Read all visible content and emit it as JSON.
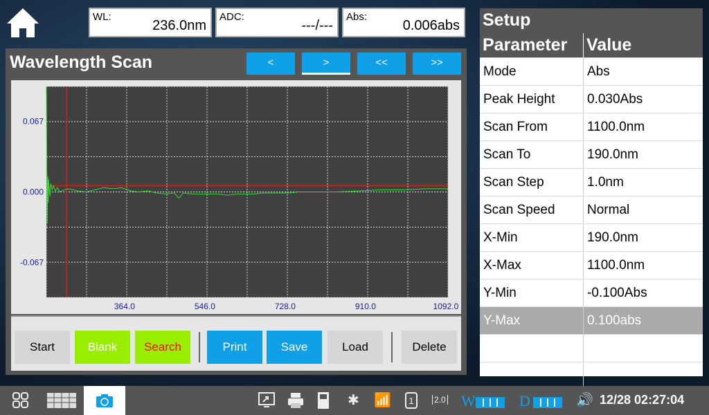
{
  "header": {
    "wl_label": "WL:",
    "wl_value": "236.0nm",
    "adc_label": "ADC:",
    "adc_value": "---/---",
    "abs_label": "Abs:",
    "abs_value": "0.006abs"
  },
  "panel": {
    "title": "Wavelength Scan",
    "nav": [
      "<",
      ">",
      "<<",
      ">>"
    ]
  },
  "buttons": {
    "start": "Start",
    "blank": "Blank",
    "search": "Search",
    "print": "Print",
    "save": "Save",
    "load": "Load",
    "delete": "Delete"
  },
  "colors": {
    "accent": "#10a0e8",
    "blank": "#99ee00",
    "search_text": "#ee1111",
    "trace": "#33dd33",
    "cursor": "#cc2222",
    "plot_bg": "#404040"
  },
  "setup": {
    "title": "Setup",
    "col_param": "Parameter",
    "col_value": "Value",
    "rows": [
      [
        "Mode",
        "Abs"
      ],
      [
        "Peak Height",
        "0.030Abs"
      ],
      [
        "Scan From",
        "1100.0nm"
      ],
      [
        "Scan To",
        "190.0nm"
      ],
      [
        "Scan Step",
        "1.0nm"
      ],
      [
        "Scan Speed",
        "Normal"
      ],
      [
        "X-Min",
        "190.0nm"
      ],
      [
        "X-Max",
        "1100.0nm"
      ],
      [
        "Y-Min",
        "-0.100Abs"
      ],
      [
        "Y-Max",
        "0.100abs"
      ]
    ],
    "selected_index": 9
  },
  "chart_data": {
    "type": "line",
    "xlim": [
      190,
      1100
    ],
    "ylim": [
      -0.1,
      0.1
    ],
    "grid": true,
    "y_ticks": [
      "0.067",
      "0.000",
      "-0.067"
    ],
    "y_tick_values": [
      0.067,
      0,
      -0.067
    ],
    "x_ticks": [
      "364.0",
      "546.0",
      "728.0",
      "910.0",
      "1092.0"
    ],
    "x_tick_values": [
      364,
      546,
      728,
      910,
      1092
    ],
    "cursor_x": 236,
    "cursor_y": 0.006,
    "series": [
      {
        "x": [
          190,
          191,
          192,
          193,
          194,
          195,
          196,
          198,
          200,
          203,
          206,
          210,
          215,
          220,
          230,
          240,
          260,
          280,
          300,
          320,
          340,
          360,
          380,
          400,
          420,
          440,
          460,
          480,
          490,
          500,
          520,
          560,
          580,
          600,
          620,
          640,
          660,
          680,
          700,
          720,
          740,
          760,
          800,
          850,
          900,
          950,
          1000,
          1050,
          1100
        ],
        "y": [
          0.1,
          0.02,
          -0.03,
          0.015,
          -0.01,
          0.012,
          0.005,
          -0.004,
          0.008,
          0.002,
          0.006,
          0.001,
          0.004,
          0.0,
          0.002,
          0.003,
          0.001,
          0.0,
          0.002,
          0.004,
          0.003,
          0.004,
          0.001,
          0.0,
          0.001,
          -0.001,
          -0.002,
          -0.001,
          -0.006,
          -0.001,
          -0.002,
          -0.002,
          -0.002,
          -0.003,
          -0.002,
          -0.002,
          -0.002,
          -0.001,
          -0.001,
          -0.001,
          -0.001,
          0.0,
          0.0,
          0.0,
          0.001,
          0.002,
          0.002,
          0.003,
          0.003
        ]
      }
    ]
  },
  "taskbar": {
    "datetime": "12/28 02:27:04",
    "version": "2.0",
    "w_label": "W",
    "d_label": "D"
  }
}
